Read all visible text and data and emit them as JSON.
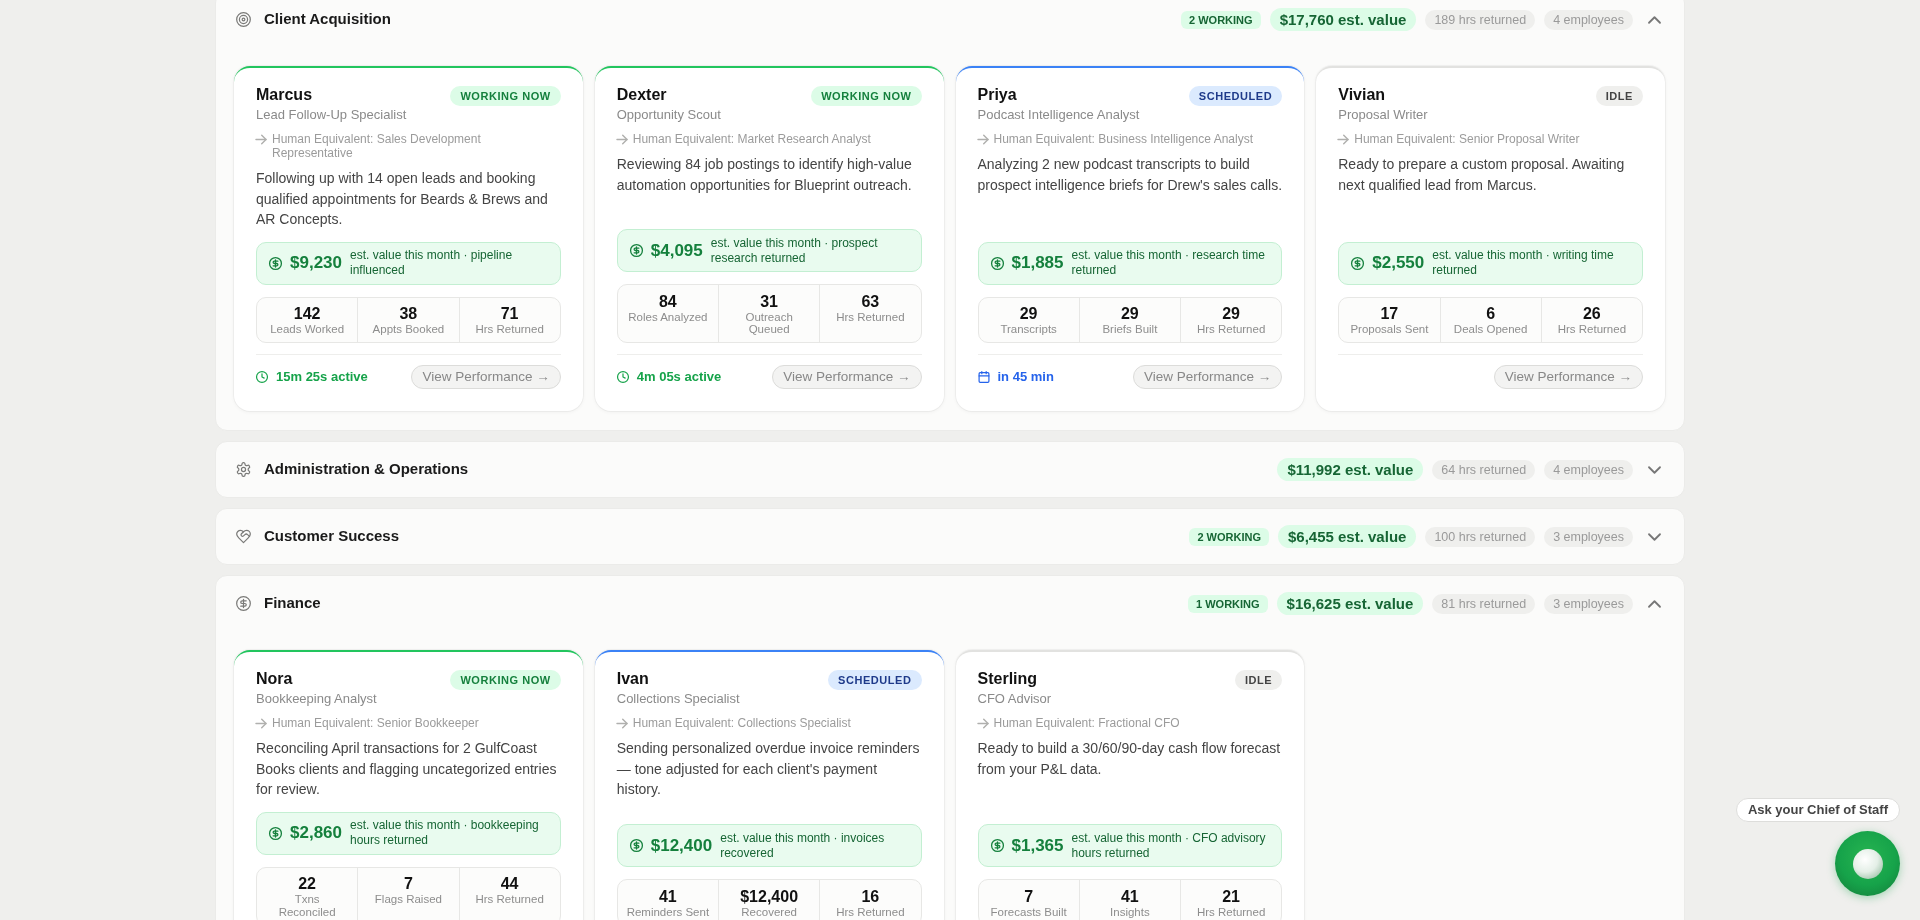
{
  "sections": [
    {
      "title": "Client Acquisition",
      "expanded": true,
      "working": "2 WORKING",
      "value": "$17,760 est. value",
      "hours": "189 hrs returned",
      "employees": "4 employees",
      "cards": [
        {
          "name": "Marcus",
          "kind": "working",
          "badge": "WORKING NOW",
          "role": "Lead Follow-Up Specialist",
          "equivalent": "Human Equivalent: Sales Development Representative",
          "description": "Following up with 14 open leads and booking qualified appointments for Beards & Brews and AR Concepts.",
          "amount": "$9,230",
          "amount_note": "est. value this month · pipeline influenced",
          "stats": [
            {
              "value": "142",
              "label": "Leads Worked"
            },
            {
              "value": "38",
              "label": "Appts Booked"
            },
            {
              "value": "71",
              "label": "Hrs Returned"
            }
          ],
          "activity": "15m 25s active",
          "action": "View Performance →"
        },
        {
          "name": "Dexter",
          "kind": "working",
          "badge": "WORKING NOW",
          "role": "Opportunity Scout",
          "equivalent": "Human Equivalent: Market Research Analyst",
          "description": "Reviewing 84 job postings to identify high-value automation opportunities for Blueprint outreach.",
          "amount": "$4,095",
          "amount_note": "est. value this month · prospect research returned",
          "stats": [
            {
              "value": "84",
              "label": "Roles Analyzed"
            },
            {
              "value": "31",
              "label": "Outreach Queued"
            },
            {
              "value": "63",
              "label": "Hrs Returned"
            }
          ],
          "activity": "4m 05s active",
          "action": "View Performance →"
        },
        {
          "name": "Priya",
          "kind": "scheduled",
          "badge": "SCHEDULED",
          "role": "Podcast Intelligence Analyst",
          "equivalent": "Human Equivalent: Business Intelligence Analyst",
          "description": "Analyzing 2 new podcast transcripts to build prospect intelligence briefs for Drew's sales calls.",
          "amount": "$1,885",
          "amount_note": "est. value this month · research time returned",
          "stats": [
            {
              "value": "29",
              "label": "Transcripts"
            },
            {
              "value": "29",
              "label": "Briefs Built"
            },
            {
              "value": "29",
              "label": "Hrs Returned"
            }
          ],
          "activity": "in 45 min",
          "action": "View Performance →"
        },
        {
          "name": "Vivian",
          "kind": "idle",
          "badge": "IDLE",
          "role": "Proposal Writer",
          "equivalent": "Human Equivalent: Senior Proposal Writer",
          "description": "Ready to prepare a custom proposal. Awaiting next qualified lead from Marcus.",
          "amount": "$2,550",
          "amount_note": "est. value this month · writing time returned",
          "stats": [
            {
              "value": "17",
              "label": "Proposals Sent"
            },
            {
              "value": "6",
              "label": "Deals Opened"
            },
            {
              "value": "26",
              "label": "Hrs Returned"
            }
          ],
          "action": "View Performance →"
        }
      ]
    },
    {
      "title": "Administration & Operations",
      "expanded": false,
      "value": "$11,992 est. value",
      "hours": "64 hrs returned",
      "employees": "4 employees"
    },
    {
      "title": "Customer Success",
      "expanded": false,
      "working": "2 WORKING",
      "value": "$6,455 est. value",
      "hours": "100 hrs returned",
      "employees": "3 employees"
    },
    {
      "title": "Finance",
      "expanded": true,
      "working": "1 WORKING",
      "value": "$16,625 est. value",
      "hours": "81 hrs returned",
      "employees": "3 employees",
      "cards": [
        {
          "name": "Nora",
          "kind": "working",
          "badge": "WORKING NOW",
          "role": "Bookkeeping Analyst",
          "equivalent": "Human Equivalent: Senior Bookkeeper",
          "description": "Reconciling April transactions for 2 GulfCoast Books clients and flagging uncategorized entries for review.",
          "amount": "$2,860",
          "amount_note": "est. value this month · bookkeeping hours returned",
          "stats": [
            {
              "value": "22",
              "label": "Txns Reconciled"
            },
            {
              "value": "7",
              "label": "Flags Raised"
            },
            {
              "value": "44",
              "label": "Hrs Returned"
            }
          ]
        },
        {
          "name": "Ivan",
          "kind": "scheduled",
          "badge": "SCHEDULED",
          "role": "Collections Specialist",
          "equivalent": "Human Equivalent: Collections Specialist",
          "description": "Sending personalized overdue invoice reminders — tone adjusted for each client's payment history.",
          "amount": "$12,400",
          "amount_note": "est. value this month · invoices recovered",
          "stats": [
            {
              "value": "41",
              "label": "Reminders Sent"
            },
            {
              "value": "$12,400",
              "label": "Recovered"
            },
            {
              "value": "16",
              "label": "Hrs Returned"
            }
          ]
        },
        {
          "name": "Sterling",
          "kind": "idle",
          "badge": "IDLE",
          "role": "CFO Advisor",
          "equivalent": "Human Equivalent: Fractional CFO",
          "description": "Ready to build a 30/60/90-day cash flow forecast from your P&L data.",
          "amount": "$1,365",
          "amount_note": "est. value this month · CFO advisory hours returned",
          "stats": [
            {
              "value": "7",
              "label": "Forecasts Built"
            },
            {
              "value": "41",
              "label": "Insights"
            },
            {
              "value": "21",
              "label": "Hrs Returned"
            }
          ]
        }
      ]
    }
  ],
  "assistant": {
    "prompt": "Ask your Chief of Staff"
  }
}
